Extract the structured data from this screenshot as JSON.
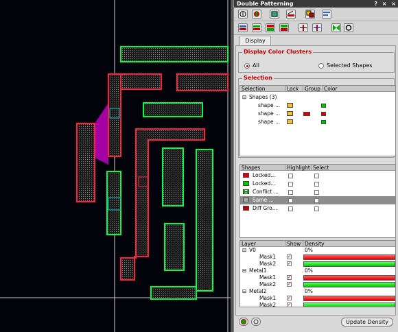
{
  "window": {
    "title": "Double Patterning",
    "controls": "? × ×"
  },
  "tabs": {
    "display": "Display"
  },
  "clusters": {
    "title": "Display Color Clusters",
    "all": "All",
    "selected": "Selected Shapes"
  },
  "selection": {
    "title": "Selection",
    "headers": [
      "Selection",
      "Lock",
      "Group",
      "Color"
    ],
    "root": "Shapes (3)",
    "items": [
      {
        "label": "shape ...",
        "color": "#00c800",
        "group": false
      },
      {
        "label": "shape ...",
        "color": "#e00000",
        "group": true
      },
      {
        "label": "shape ...",
        "color": "#00c800",
        "group": false
      }
    ]
  },
  "shapes": {
    "headers": [
      "Shapes",
      "Highlight",
      "Select"
    ],
    "items": [
      {
        "label": "Locked...",
        "icon": "lock-red-icon",
        "highlight": false,
        "select": false,
        "selected": false
      },
      {
        "label": "Locked...",
        "icon": "lock-green-icon",
        "highlight": false,
        "select": false,
        "selected": false
      },
      {
        "label": "Conflict ...",
        "icon": "conflict-icon",
        "highlight": false,
        "select": false,
        "selected": false
      },
      {
        "label": "Same ...",
        "icon": "same-icon",
        "highlight": false,
        "select": false,
        "selected": true
      },
      {
        "label": "Diff Gro...",
        "icon": "diff-icon",
        "highlight": false,
        "select": false,
        "selected": false
      }
    ]
  },
  "layers": {
    "headers": [
      "Layer",
      "Show",
      "Density"
    ],
    "groups": [
      {
        "name": "V0",
        "density": "0%",
        "masks": [
          {
            "name": "Mask1",
            "color": "#e00000"
          },
          {
            "name": "Mask2",
            "color": "#00c800"
          }
        ]
      },
      {
        "name": "Metal1",
        "density": "0%",
        "masks": [
          {
            "name": "Mask1",
            "color": "#e00000"
          },
          {
            "name": "Mask2",
            "color": "#00c800"
          }
        ]
      },
      {
        "name": "Metal2",
        "density": "0%",
        "masks": [
          {
            "name": "Mask1",
            "color": "#e00000"
          },
          {
            "name": "Mask2",
            "color": "#00c800"
          }
        ]
      }
    ]
  },
  "footer": {
    "update": "Update Density"
  },
  "colors": {
    "mask1": "#e00000",
    "mask2": "#00c800",
    "conflict": "#c000c0",
    "accent": "#c00000"
  }
}
